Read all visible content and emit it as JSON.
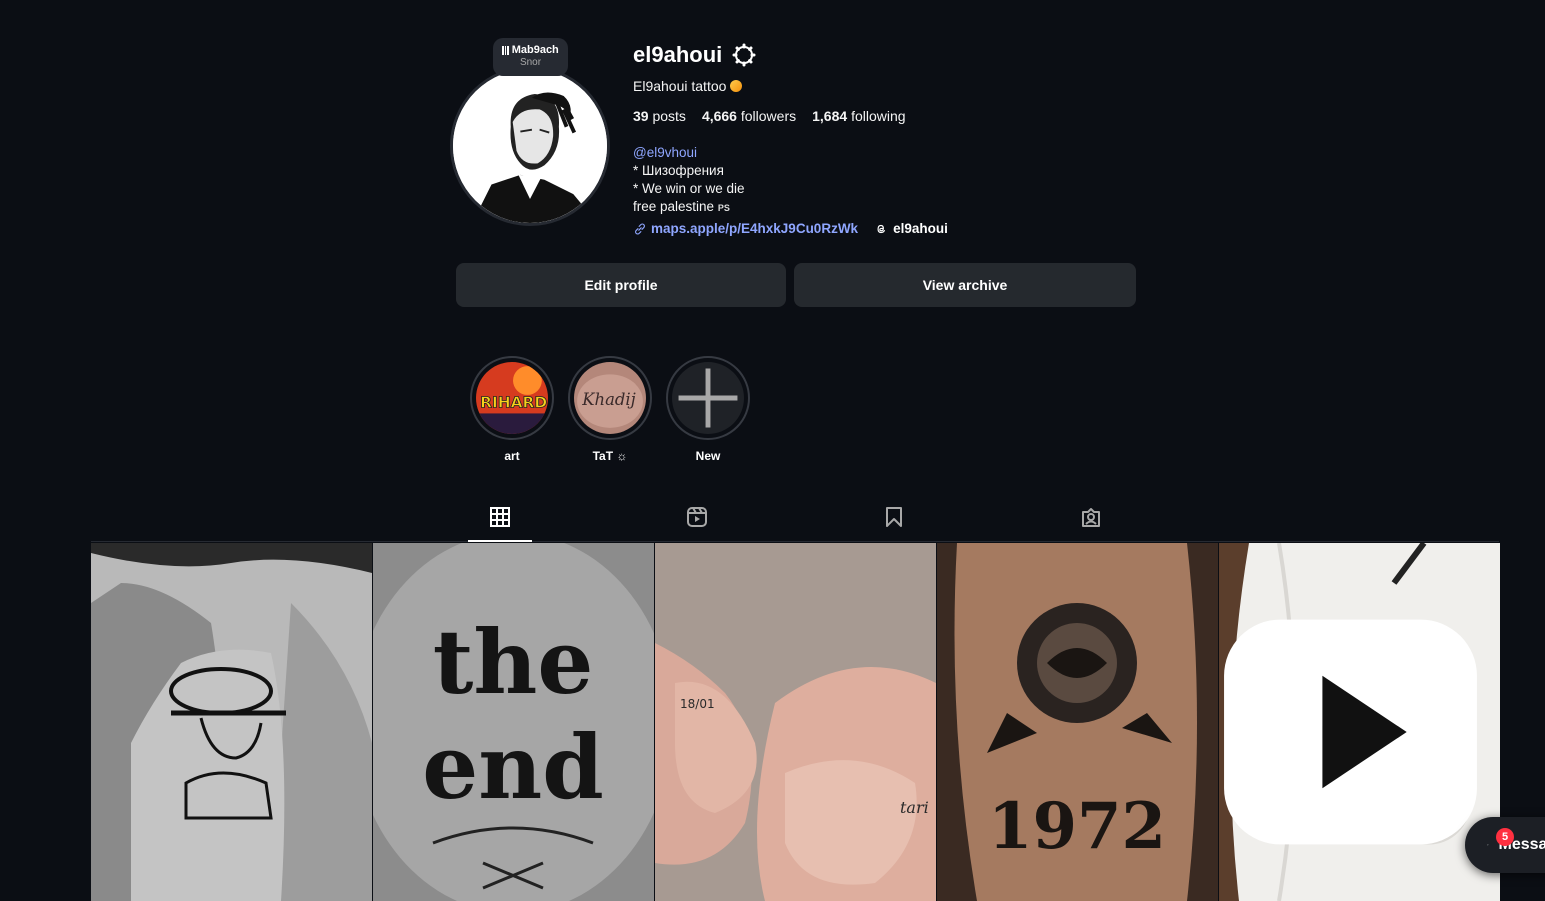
{
  "note": {
    "title": "Mab9ach",
    "subtitle": "Snor"
  },
  "profile": {
    "username": "el9ahoui",
    "full_name": "El9ahoui tattoo",
    "stats": {
      "posts_count": "39",
      "posts_label": "posts",
      "followers_count": "4,666",
      "followers_label": "followers",
      "following_count": "1,684",
      "following_label": "following"
    },
    "bio": {
      "mention": "@el9vhoui",
      "line1": "* Шизофрения",
      "line2": "* We win or we die",
      "line3": "free palestine",
      "line3_tag": "PS"
    },
    "link": "maps.apple/p/E4hxkJ9Cu0RzWk",
    "threads_handle": "el9ahoui"
  },
  "buttons": {
    "edit_profile": "Edit profile",
    "view_archive": "View archive"
  },
  "highlights": [
    {
      "label": "art"
    },
    {
      "label": "TaT ☼"
    },
    {
      "label": "New"
    }
  ],
  "tabs": [
    "posts-grid-icon",
    "reels-icon",
    "saved-icon",
    "tagged-icon"
  ],
  "messages": {
    "label": "Messages",
    "badge": "5"
  },
  "colors": {
    "background": "#0b0e14",
    "button": "#25292e",
    "link": "#8fa6ff",
    "badge": "#ff3040"
  }
}
